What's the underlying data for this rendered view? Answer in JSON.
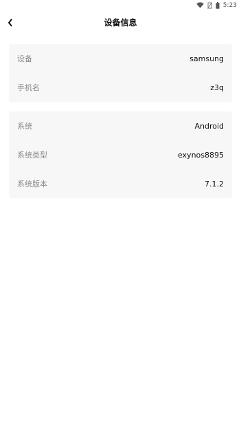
{
  "status_bar": {
    "time": "5:23",
    "icons": [
      "wifi-icon",
      "no-sim-icon",
      "battery-icon"
    ]
  },
  "header": {
    "title": "设备信息",
    "back_icon": "back-chevron-icon"
  },
  "device_card": {
    "rows": [
      {
        "label": "设备",
        "value": "samsung"
      },
      {
        "label": "手机名",
        "value": "z3q"
      }
    ]
  },
  "system_card": {
    "rows": [
      {
        "label": "系统",
        "value": "Android"
      },
      {
        "label": "系统类型",
        "value": "exynos8895"
      },
      {
        "label": "系统版本",
        "value": "7.1.2"
      }
    ]
  },
  "colors": {
    "card_background": "#f7f7f7",
    "label_text": "#8a8a8a",
    "value_text": "#111111"
  }
}
